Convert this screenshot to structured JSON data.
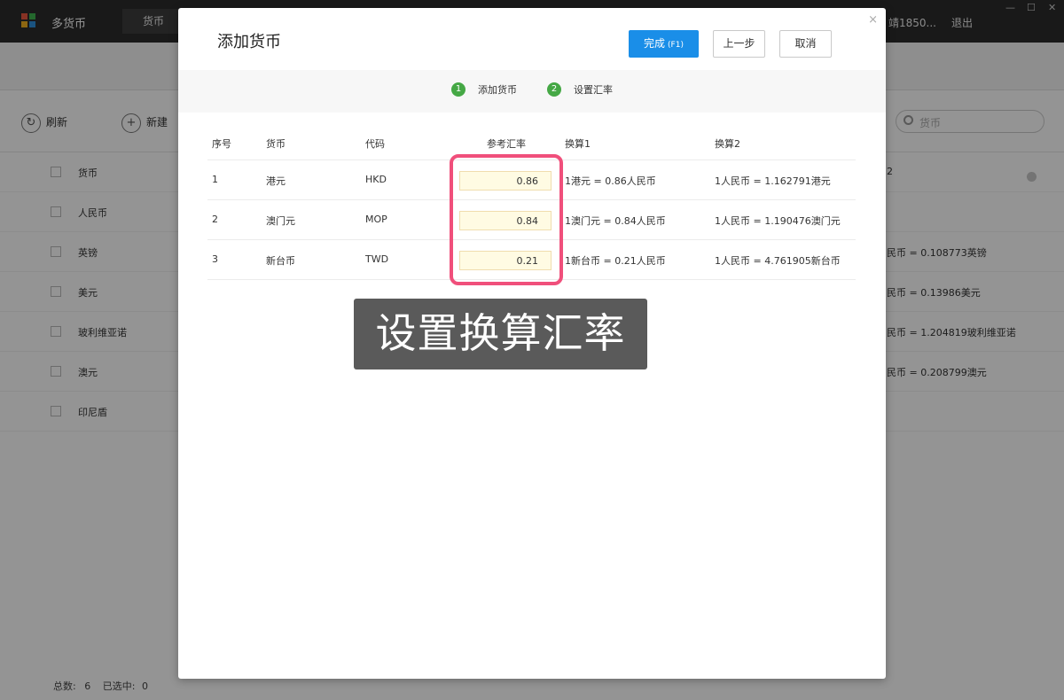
{
  "app": {
    "title": "多货币",
    "active_tab": "货币",
    "user": "靖1850...",
    "logout": "退出",
    "window_controls": {
      "minimize": "—",
      "maximize": "☐",
      "close": "✕"
    }
  },
  "toolbar": {
    "refresh": "刷新",
    "add": "新建"
  },
  "search": {
    "placeholder": "货币"
  },
  "background_list": {
    "header": "货币",
    "items": [
      {
        "name": "人民币",
        "conversion": ""
      },
      {
        "name": "英镑",
        "conversion": "民币 = 0.108773英镑"
      },
      {
        "name": "美元",
        "conversion": "民币 = 0.13986美元"
      },
      {
        "name": "玻利维亚诺",
        "conversion": "民币 = 1.204819玻利维亚诺"
      },
      {
        "name": "澳元",
        "conversion": "民币 = 0.208799澳元"
      },
      {
        "name": "印尼盾",
        "conversion": ""
      }
    ],
    "header_conv": "2"
  },
  "footer": {
    "total_label": "总数:",
    "total": "6",
    "selected_label": "已选中:",
    "selected": "0"
  },
  "modal": {
    "title": "添加货币",
    "close": "×",
    "buttons": {
      "done": "完成",
      "done_hint": "(F1)",
      "prev": "上一步",
      "cancel": "取消"
    },
    "steps": [
      {
        "num": "1",
        "label": "添加货币"
      },
      {
        "num": "2",
        "label": "设置汇率"
      }
    ],
    "table": {
      "headers": {
        "index": "序号",
        "currency": "货币",
        "code": "代码",
        "rate": "参考汇率",
        "conv1": "换算1",
        "conv2": "换算2"
      },
      "rows": [
        {
          "index": "1",
          "currency": "港元",
          "code": "HKD",
          "rate": "0.86",
          "conv1": "1港元 = 0.86人民币",
          "conv2": "1人民币 = 1.162791港元"
        },
        {
          "index": "2",
          "currency": "澳门元",
          "code": "MOP",
          "rate": "0.84",
          "conv1": "1澳门元 = 0.84人民币",
          "conv2": "1人民币 = 1.190476澳门元"
        },
        {
          "index": "3",
          "currency": "新台币",
          "code": "TWD",
          "rate": "0.21",
          "conv1": "1新台币 = 0.21人民币",
          "conv2": "1人民币 = 4.761905新台币"
        }
      ]
    }
  },
  "caption": "设置换算汇率",
  "colors": {
    "primary": "#1a8ee8",
    "step": "#45a845",
    "highlight": "#f04f7b",
    "input_bg": "#fffbe3"
  }
}
